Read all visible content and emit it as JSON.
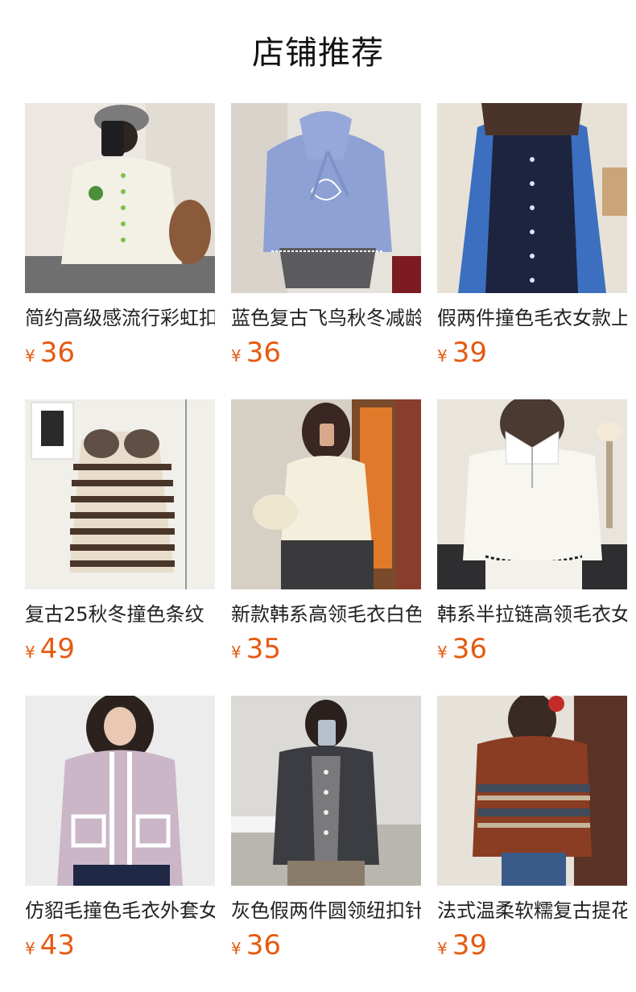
{
  "section_title": "店铺推荐",
  "currency_symbol": "¥",
  "accent_price_color": "#e55a12",
  "products": [
    {
      "name": "简约高级感流行彩虹扣针织开衫",
      "price": "36",
      "icon": "product-photo"
    },
    {
      "name": "蓝色复古飞鸟秋冬减龄毛衣",
      "price": "36",
      "icon": "product-photo"
    },
    {
      "name": "假两件撞色毛衣女款上衣",
      "price": "39",
      "icon": "product-photo"
    },
    {
      "name": "复古25秋冬撞色条纹",
      "price": "49",
      "icon": "product-photo"
    },
    {
      "name": "新款韩系高领毛衣白色上衣",
      "price": "35",
      "icon": "product-photo"
    },
    {
      "name": "韩系半拉链高领毛衣女",
      "price": "36",
      "icon": "product-photo"
    },
    {
      "name": "仿貂毛撞色毛衣外套女",
      "price": "43",
      "icon": "product-photo"
    },
    {
      "name": "灰色假两件圆领纽扣针织衫",
      "price": "36",
      "icon": "product-photo"
    },
    {
      "name": "法式温柔软糯复古提花毛衣",
      "price": "39",
      "icon": "product-photo"
    }
  ]
}
